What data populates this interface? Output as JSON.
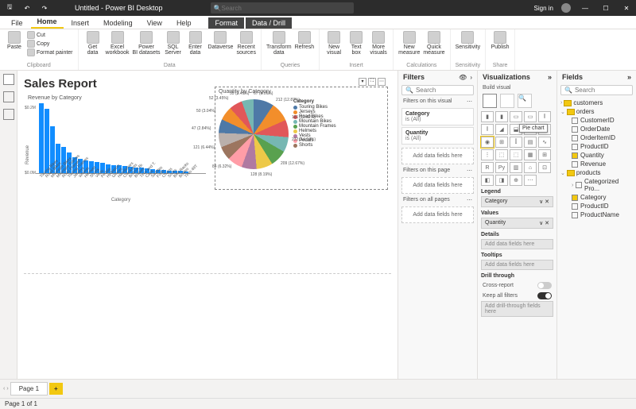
{
  "titlebar": {
    "title": "Untitled - Power BI Desktop",
    "search_placeholder": "Search",
    "signin": "Sign in"
  },
  "ribbon_tabs": [
    "File",
    "Home",
    "Insert",
    "Modeling",
    "View",
    "Help"
  ],
  "ribbon_ctx": [
    "Format",
    "Data / Drill"
  ],
  "ribbon_active": "Home",
  "ribbon": {
    "clipboard": {
      "label": "Clipboard",
      "paste": "Paste",
      "cut": "Cut",
      "copy": "Copy",
      "fmt": "Format painter"
    },
    "data": {
      "label": "Data",
      "items": [
        "Get data",
        "Excel workbook",
        "Power BI datasets",
        "SQL Server",
        "Enter data",
        "Dataverse",
        "Recent sources"
      ]
    },
    "queries": {
      "label": "Queries",
      "items": [
        "Transform data",
        "Refresh"
      ]
    },
    "insert": {
      "label": "Insert",
      "items": [
        "New visual",
        "Text box",
        "More visuals"
      ]
    },
    "calc": {
      "label": "Calculations",
      "items": [
        "New measure",
        "Quick measure"
      ]
    },
    "sens": {
      "label": "Sensitivity",
      "items": [
        "Sensitivity"
      ]
    },
    "share": {
      "label": "Share",
      "items": [
        "Publish"
      ]
    }
  },
  "page_title": "Sales Report",
  "bar_viz": {
    "title": "Revenue by Category",
    "ylabel": "Revenue",
    "xlabel": "Category",
    "yticks": [
      "$0.2M",
      "$0.0M"
    ],
    "categories": [
      "Touring Bikes",
      "Road Bikes",
      "Mountain Bikes",
      "Mountain Frames",
      "Road Frames",
      "Touring Frames",
      "Jerseys",
      "Wheels",
      "Helmets",
      "Shorts",
      "Vests",
      "Pedals",
      "Hydration",
      "Gloves",
      "Handlebars",
      "Cranksets",
      "Bottom Br.",
      "Brakes",
      "Tires and T.",
      "Caps",
      "Saddles",
      "Forks",
      "Chains",
      "Socks",
      "Bike Racks",
      "Bottles",
      "Tires 48T"
    ],
    "values": [
      0.24,
      0.22,
      0.16,
      0.1,
      0.09,
      0.07,
      0.055,
      0.05,
      0.045,
      0.04,
      0.038,
      0.035,
      0.03,
      0.028,
      0.026,
      0.024,
      0.022,
      0.02,
      0.018,
      0.016,
      0.014,
      0.012,
      0.01,
      0.009,
      0.008,
      0.007,
      0.006
    ]
  },
  "pie_viz": {
    "title": "Quantity by Category",
    "legend_title": "Category",
    "legend": [
      "Touring Bikes",
      "Jerseys",
      "Road Bikes",
      "Mountain Bikes",
      "Mountain Frames",
      "Helmets",
      "Vests",
      "Pedals",
      "Shorts"
    ],
    "slice_labels": [
      "212 (12.87%)",
      "181 (11.02%)",
      "232 (14.04%)",
      "209 (12.67%)",
      "128 (8.19%)",
      "84 (6.32%)",
      "121 (6.44%)",
      "47 (2.84%)",
      "50 (3.04%)",
      "52 (3.45%)",
      "55 (3.49%)",
      "67 (4.06%)"
    ]
  },
  "filters": {
    "title": "Filters",
    "search_placeholder": "Search",
    "on_visual": "Filters on this visual",
    "cards": [
      {
        "name": "Category",
        "state": "is (All)"
      },
      {
        "name": "Quantity",
        "state": "is (All)"
      }
    ],
    "on_page": "Filters on this page",
    "on_all": "Filters on all pages",
    "add": "Add data fields here"
  },
  "vizpane": {
    "title": "Visualizations",
    "build": "Build visual",
    "legend": "Legend",
    "legend_field": "Category",
    "values": "Values",
    "values_field": "Quantity",
    "details": "Details",
    "tooltips": "Tooltips",
    "drill": "Drill through",
    "cross": "Cross-report",
    "keep": "Keep all filters",
    "add": "Add data fields here",
    "add_drill": "Add drill-through fields here",
    "tooltip": "Pie chart"
  },
  "fields": {
    "title": "Fields",
    "search_placeholder": "Search",
    "tables": [
      {
        "name": "customers",
        "expanded": false,
        "fields": []
      },
      {
        "name": "orders",
        "expanded": true,
        "fields": [
          {
            "name": "CustomerID",
            "checked": false
          },
          {
            "name": "OrderDate",
            "checked": false
          },
          {
            "name": "OrderItemID",
            "checked": false
          },
          {
            "name": "ProductID",
            "checked": false
          },
          {
            "name": "Quantity",
            "checked": true
          },
          {
            "name": "Revenue",
            "checked": false
          }
        ]
      },
      {
        "name": "products",
        "expanded": true,
        "fields": [
          {
            "name": "Categorized Pro...",
            "checked": false,
            "hier": true
          },
          {
            "name": "Category",
            "checked": true
          },
          {
            "name": "ProductID",
            "checked": false
          },
          {
            "name": "ProductName",
            "checked": false
          }
        ]
      }
    ]
  },
  "pages": {
    "current": "Page 1",
    "status": "Page 1 of 1"
  },
  "chart_data": {
    "type": "bar",
    "title": "Revenue by Category",
    "xlabel": "Category",
    "ylabel": "Revenue",
    "ylim": [
      0,
      0.25
    ],
    "categories": [
      "Touring Bikes",
      "Road Bikes",
      "Mountain Bikes",
      "Mountain Frames",
      "Road Frames",
      "Touring Frames",
      "Jerseys",
      "Wheels",
      "Helmets",
      "Shorts",
      "Vests",
      "Pedals",
      "Hydration",
      "Gloves",
      "Handlebars",
      "Cranksets",
      "Bottom Brackets",
      "Brakes",
      "Tires and Tubes",
      "Caps",
      "Saddles",
      "Forks",
      "Chains",
      "Socks",
      "Bike Racks",
      "Bottles",
      "Tires"
    ],
    "values": [
      0.24,
      0.22,
      0.16,
      0.1,
      0.09,
      0.07,
      0.055,
      0.05,
      0.045,
      0.04,
      0.038,
      0.035,
      0.03,
      0.028,
      0.026,
      0.024,
      0.022,
      0.02,
      0.018,
      0.016,
      0.014,
      0.012,
      0.01,
      0.009,
      0.008,
      0.007,
      0.006
    ]
  }
}
